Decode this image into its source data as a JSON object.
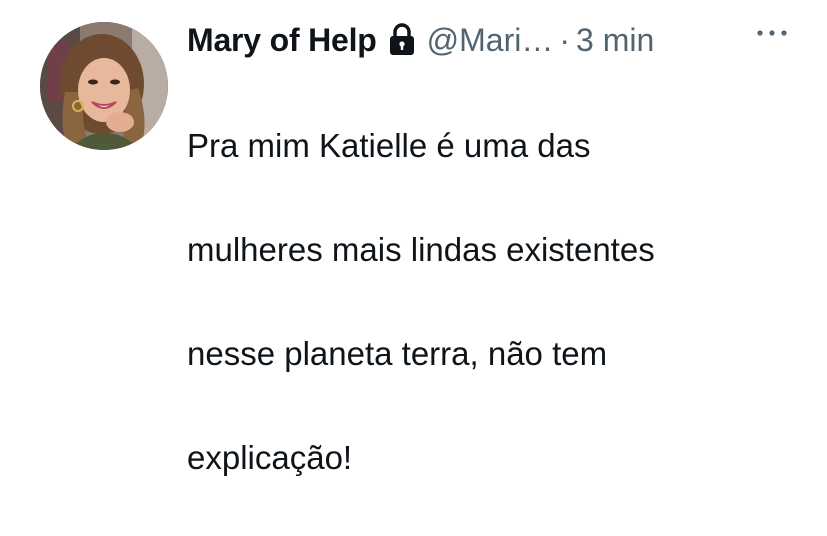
{
  "tweet": {
    "display_name": "Mary of Help",
    "handle": "@Mari…",
    "separator": "·",
    "time": "3 min",
    "text_lines": [
      "Pra mim Katielle é uma das",
      "mulheres mais lindas existentes",
      "nesse planeta terra, não tem",
      "explicação!"
    ],
    "protected_icon": "lock-icon",
    "more_icon": "more-horizontal-icon",
    "avatar_icon": "profile-photo"
  },
  "colors": {
    "text_primary": "#0f1419",
    "text_secondary": "#536471",
    "background": "#ffffff"
  }
}
